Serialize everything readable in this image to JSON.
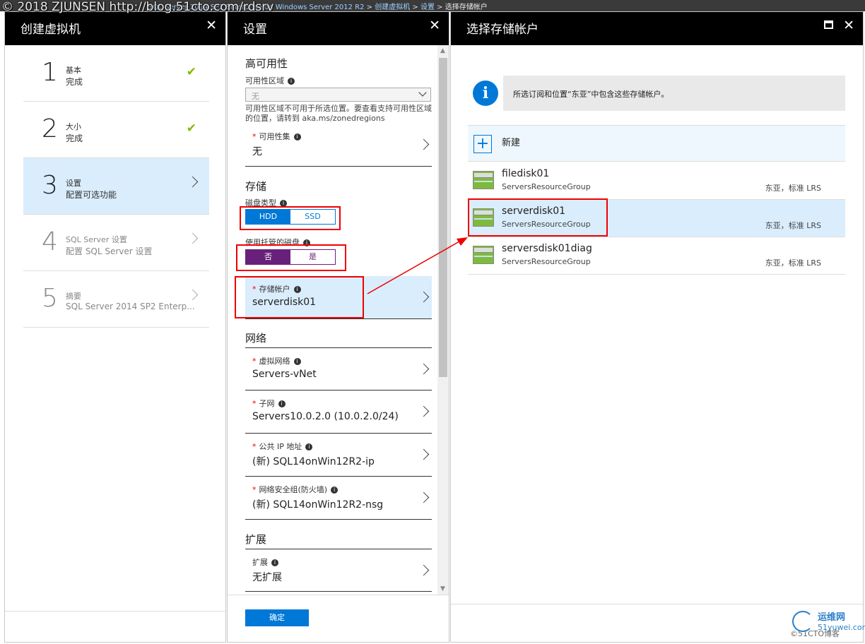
{
  "watermark": "© 2018 ZJUNSEN  http://blog.51cto.com/rdsrv",
  "breadcrumb": {
    "hidden": "SQL Server 2014 SP2 Enterprise on Windows Server 2012 R2",
    "items": [
      "创建虚拟机",
      "设置"
    ],
    "current": "选择存储帐户"
  },
  "blade1": {
    "title": "创建虚拟机",
    "steps": [
      {
        "num": "1",
        "l1": "基本",
        "l2": "完成"
      },
      {
        "num": "2",
        "l1": "大小",
        "l2": "完成"
      },
      {
        "num": "3",
        "l1": "设置",
        "l2": "配置可选功能"
      },
      {
        "num": "4",
        "l1": "SQL Server 设置",
        "l2": "配置 SQL Server 设置"
      },
      {
        "num": "5",
        "l1": "摘要",
        "l2": "SQL Server 2014 SP2 Enterp..."
      }
    ]
  },
  "blade2": {
    "title": "设置",
    "ha": {
      "section": "高可用性",
      "zone_label": "可用性区域",
      "zone_value": "无",
      "zone_note": "可用性区域不可用于所选位置。要查看支持可用性区域的位置，请转到 aka.ms/zonedregions",
      "set_label": "可用性集",
      "set_value": "无"
    },
    "storage": {
      "section": "存储",
      "disk_type_label": "磁盘类型",
      "hdd": "HDD",
      "ssd": "SSD",
      "managed_label": "使用托管的磁盘",
      "no": "否",
      "yes": "是",
      "account_label": "存储帐户",
      "account_value": "serverdisk01"
    },
    "network": {
      "section": "网络",
      "vnet_label": "虚拟网络",
      "vnet_value": "Servers-vNet",
      "subnet_label": "子网",
      "subnet_value": "Servers10.0.2.0 (10.0.2.0/24)",
      "ip_label": "公共 IP 地址",
      "ip_value": "(新) SQL14onWin12R2-ip",
      "nsg_label": "网络安全组(防火墙)",
      "nsg_value": "(新) SQL14onWin12R2-nsg"
    },
    "ext": {
      "section": "扩展",
      "label": "扩展",
      "value": "无扩展"
    },
    "ok": "确定"
  },
  "blade3": {
    "title": "选择存储帐户",
    "info": "所选订阅和位置“东亚”中包含这些存储帐户。",
    "new_label": "新建",
    "accounts": [
      {
        "name": "filedisk01",
        "group": "ServersResourceGroup",
        "region": "东亚，标准 LRS"
      },
      {
        "name": "serverdisk01",
        "group": "ServersResourceGroup",
        "region": "东亚，标准 LRS"
      },
      {
        "name": "serversdisk01diag",
        "group": "ServersResourceGroup",
        "region": "东亚，标准 LRS"
      }
    ]
  },
  "logo": {
    "cn": "运维网",
    "en": "51yuwei.com"
  },
  "footer_watermark": "©51CTO博客",
  "colors": {
    "accent": "#0078d7",
    "managed": "#68217a",
    "check": "#7fba00",
    "highlight": "#e00000"
  }
}
